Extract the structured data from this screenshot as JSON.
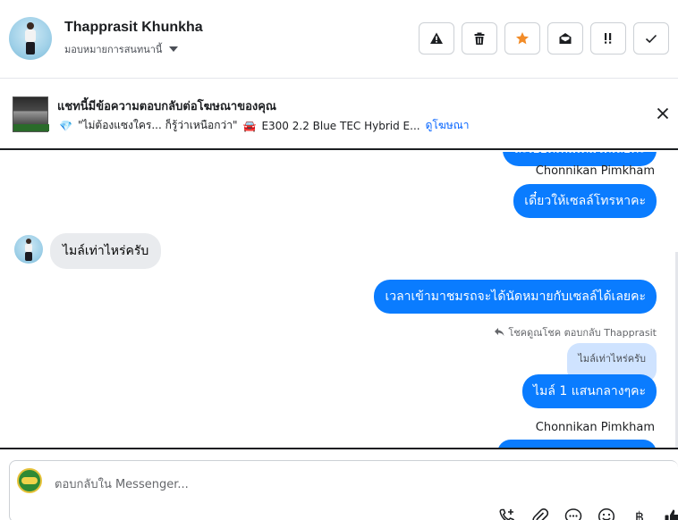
{
  "header": {
    "name": "Thapprasit Khunkha",
    "assign_label": "มอบหมายการสนทนานี้",
    "actions": [
      {
        "icon": "warning-icon",
        "color": "#1c1e21"
      },
      {
        "icon": "trash-icon",
        "color": "#1c1e21"
      },
      {
        "icon": "star-icon",
        "color": "#f28c28"
      },
      {
        "icon": "mail-open-icon",
        "color": "#1c1e21"
      },
      {
        "icon": "priority-icon",
        "color": "#1c1e21"
      },
      {
        "icon": "check-icon",
        "color": "#1c1e21"
      }
    ]
  },
  "ad": {
    "title": "แชทนี้มีข้อความตอบกลับต่อโฆษณาของคุณ",
    "snippet_prefix_icon": "💎",
    "snippet_text": "\"ไม่ต้องแซงใคร... ก็รู้ว่าเหนือกว่า\"",
    "car_icon": "🚘",
    "snippet_model": "E300 2.2 Blue TEC Hybrid E...",
    "link": "ดูโฆษณา"
  },
  "messages": [
    {
      "kind": "out",
      "text": "ละเอียดเพิ่มเติมได้เลยค่ะ"
    },
    {
      "kind": "sender",
      "text": "Chonnikan Pimkham"
    },
    {
      "kind": "out",
      "text": "เดี๋ยวให้เซลล์โทรหาคะ"
    },
    {
      "kind": "in",
      "text": "ไมล์เท่าไหร่ครับ"
    },
    {
      "kind": "out",
      "text": "เวลาเข้ามาชมรถจะได้นัดหมายกับเซลล์ได้เลยคะ"
    },
    {
      "kind": "reply_note",
      "text": "โชคดูณโชค ตอบกลับ Thapprasit"
    },
    {
      "kind": "quoted",
      "text": "ไมล์เท่าไหร่ครับ"
    },
    {
      "kind": "out",
      "text": "ไมล์ 1 แสนกลางๆคะ"
    },
    {
      "kind": "sender",
      "text": "Chonnikan Pimkham"
    }
  ],
  "composer": {
    "placeholder": "ตอบกลับใน Messenger...",
    "icons": [
      "phone-plus-icon",
      "paperclip-icon",
      "chat-bubble-icon",
      "emoji-icon",
      "baht-icon",
      "thumbs-up-icon"
    ],
    "baht_symbol": "฿"
  }
}
